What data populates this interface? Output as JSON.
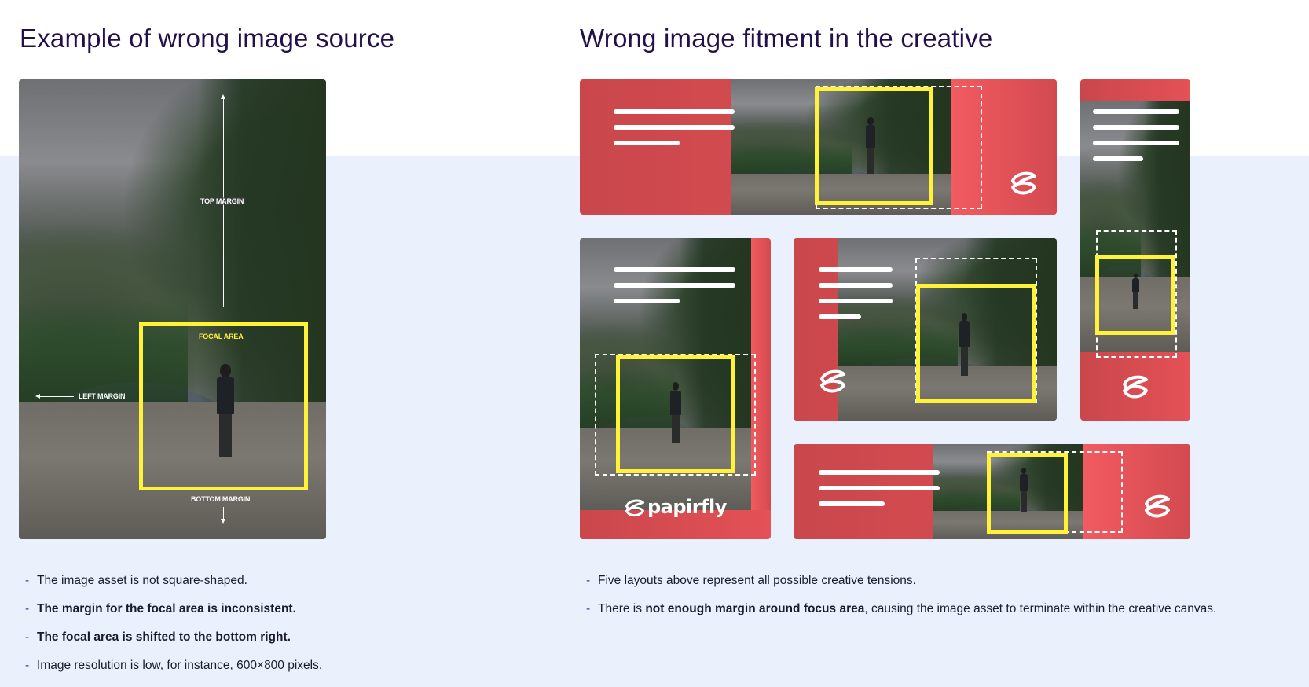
{
  "left": {
    "heading": "Example of wrong image source",
    "labels": {
      "top_margin": "TOP MARGIN",
      "focal_area": "FOCAL AREA",
      "left_margin": "LEFT MARGIN",
      "bottom_margin": "BOTTOM MARGIN"
    },
    "bullets": [
      {
        "text": "The image asset is not square-shaped.",
        "bold": false
      },
      {
        "text": "The margin for the focal area is inconsistent.",
        "bold": true
      },
      {
        "text": "The focal area is shifted to the bottom right.",
        "bold": true
      },
      {
        "text": "Image resolution is low, for instance, 600×800 pixels.",
        "bold": false
      }
    ]
  },
  "right": {
    "heading": "Wrong image fitment in the creative",
    "wordmark": "papirfly",
    "bullets": [
      {
        "pre": "Five layouts above represent all possible creative tensions.",
        "bold": "",
        "post": ""
      },
      {
        "pre": "There is ",
        "bold": "not enough margin around focus area",
        "post": ", causing the image asset to terminate within the creative canvas."
      }
    ]
  },
  "bullet_marker": "-",
  "colors": {
    "heading": "#23104a",
    "brand_red": "#e45157",
    "focal_yellow": "#fff238",
    "background_lower": "#eaf1fc"
  },
  "icons": [
    "papirfly-logo-icon"
  ]
}
